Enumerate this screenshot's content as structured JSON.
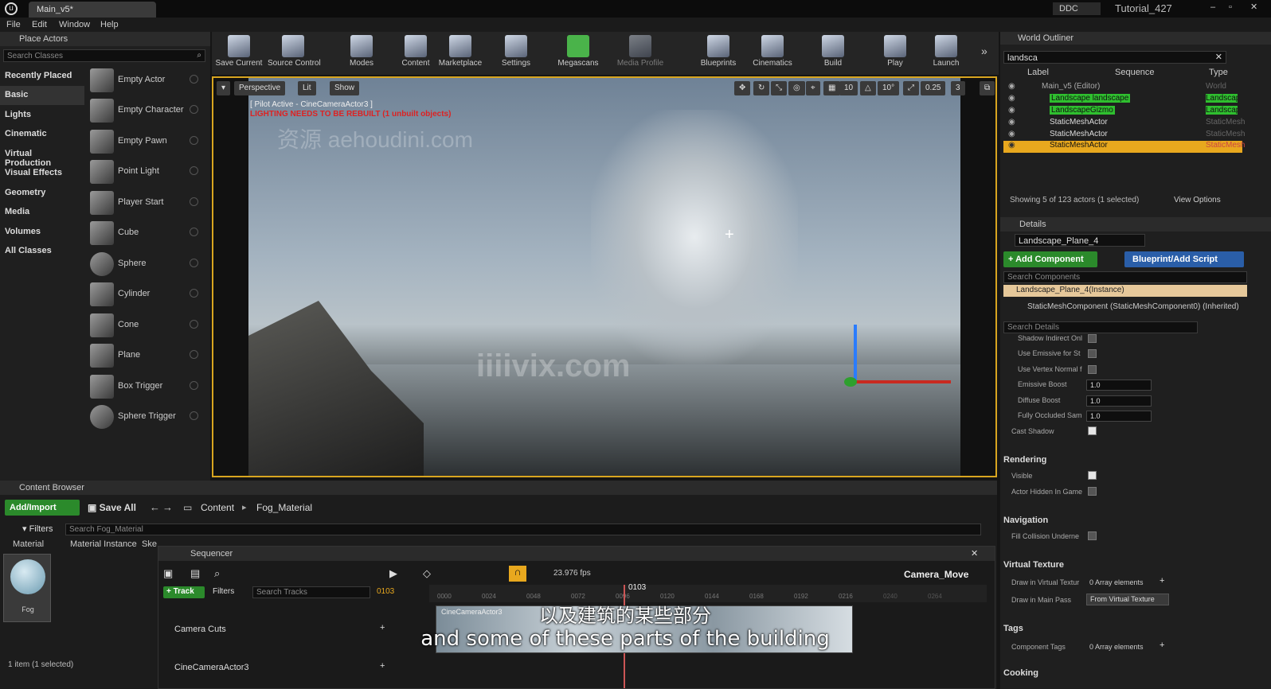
{
  "window": {
    "tab": "Main_v5*",
    "ddc": "DDC",
    "project": "Tutorial_427"
  },
  "menu": [
    "File",
    "Edit",
    "Window",
    "Help"
  ],
  "place_actors": {
    "title": "Place Actors",
    "search_placeholder": "Search Classes",
    "categories": [
      "Recently Placed",
      "Basic",
      "Lights",
      "Cinematic",
      "Virtual Production",
      "Visual Effects",
      "Geometry",
      "Media",
      "Volumes",
      "All Classes"
    ],
    "actors": [
      "Empty Actor",
      "Empty Character",
      "Empty Pawn",
      "Point Light",
      "Player Start",
      "Cube",
      "Sphere",
      "Cylinder",
      "Cone",
      "Plane",
      "Box Trigger",
      "Sphere Trigger"
    ]
  },
  "toolbar": [
    "Save Current",
    "Source Control",
    "Modes",
    "Content",
    "Marketplace",
    "Settings",
    "Megascans",
    "Media Profile",
    "Blueprints",
    "Cinematics",
    "Build",
    "Play",
    "Launch"
  ],
  "viewport": {
    "perspective": "Perspective",
    "lit": "Lit",
    "show": "Show",
    "pilot": "[ Pilot Active - CineCameraActor3 ]",
    "warning": "LIGHTING NEEDS TO BE REBUILT (1 unbuilt objects)",
    "grid_snap": "10",
    "rot_snap": "10°",
    "scale_snap": "0.25",
    "cam_speed": "3",
    "watermark1": "资源 aehoudini.com",
    "watermark2": "iiiivix.com"
  },
  "outliner": {
    "title": "World Outliner",
    "search": "landsca",
    "col_label": "Label",
    "col_sequence": "Sequence",
    "col_type": "Type",
    "rows": [
      {
        "label": "Main_v5 (Editor)",
        "type": "World"
      },
      {
        "label": "Landscape landscape",
        "type": "Landscape"
      },
      {
        "label": "LandscapeGizmo",
        "type": "Landscape"
      },
      {
        "label": "StaticMeshActor",
        "type": "StaticMesh"
      },
      {
        "label": "StaticMeshActor",
        "type": "StaticMesh"
      },
      {
        "label": "StaticMeshActor",
        "type": "StaticMesh"
      }
    ],
    "status": "Showing 5 of 123 actors (1 selected)",
    "view_options": "View Options"
  },
  "details": {
    "title": "Details",
    "name": "Landscape_Plane_4",
    "add_component": "+ Add Component",
    "blueprint": "Blueprint/Add Script",
    "search_components": "Search Components",
    "instance": "Landscape_Plane_4(Instance)",
    "component": "StaticMeshComponent (StaticMeshComponent0) (Inherited)",
    "search_details": "Search Details",
    "props": [
      "Shadow Indirect Onl",
      "Use Emissive for St",
      "Use Vertex Normal f"
    ],
    "emissive_boost": {
      "label": "Emissive Boost",
      "value": "1.0"
    },
    "diffuse_boost": {
      "label": "Diffuse Boost",
      "value": "1.0"
    },
    "fully_occluded": {
      "label": "Fully Occluded Sam",
      "value": "1.0"
    },
    "cast_shadow": "Cast Shadow",
    "rendering": "Rendering",
    "visible": "Visible",
    "hidden_game": "Actor Hidden In Game",
    "navigation": "Navigation",
    "fill_collision": "Fill Collision Underne",
    "virtual_texture": "Virtual Texture",
    "draw_vt": "Draw in Virtual Textur",
    "array_elements": "0 Array elements",
    "draw_main": "Draw in Main Pass",
    "from_vt": "From Virtual Texture",
    "tags": "Tags",
    "component_tags": "Component Tags",
    "array_elements2": "0 Array elements",
    "cooking": "Cooking"
  },
  "content_browser": {
    "title": "Content Browser",
    "add_import": "Add/Import",
    "save_all": "Save All",
    "path": [
      "Content",
      "Fog_Material"
    ],
    "filters": "Filters",
    "search": "Search Fog_Material",
    "filter_tabs": [
      "Material",
      "Material Instance",
      "Ske"
    ],
    "asset": "Fog",
    "status": "1 item (1 selected)"
  },
  "sequencer": {
    "title": "Sequencer",
    "fps": "23.976 fps",
    "name": "Camera_Move",
    "track": "+ Track",
    "filters": "Filters",
    "search": "Search Tracks",
    "frame": "0103",
    "ticks": [
      "0000",
      "0024",
      "0048",
      "0072",
      "0096",
      "0120",
      "0144",
      "0168",
      "0192",
      "0216",
      "0240",
      "0264"
    ],
    "tracks": [
      "Camera Cuts",
      "CineCameraActor3"
    ],
    "clip": "CineCameraActor3"
  },
  "subtitle": {
    "zh": "以及建筑的某些部分",
    "en": "and some of these parts of the building"
  }
}
